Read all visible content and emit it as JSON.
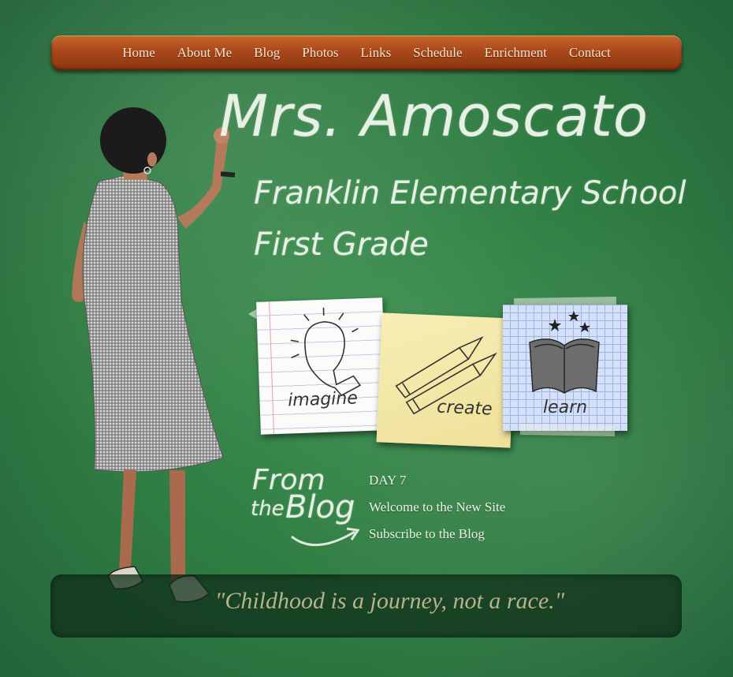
{
  "nav": {
    "items": [
      "Home",
      "About Me",
      "Blog",
      "Photos",
      "Links",
      "Schedule",
      "Enrichment",
      "Contact"
    ]
  },
  "header": {
    "title": "Mrs. Amoscato",
    "school": "Franklin Elementary School",
    "grade": "First Grade"
  },
  "cards": {
    "imagine": "imagine",
    "create": "create",
    "learn": "learn"
  },
  "blog": {
    "heading_from": "From",
    "heading_the": "the",
    "heading_blog": "Blog",
    "links": [
      "DAY 7",
      "Welcome to the New Site",
      "Subscribe to the Blog"
    ]
  },
  "quote": "\"Childhood is a journey, not a race.\"",
  "colors": {
    "chalkboard": "#2f7c42",
    "nav_wood": "#a9481a",
    "quote_text": "#b8b38c"
  }
}
